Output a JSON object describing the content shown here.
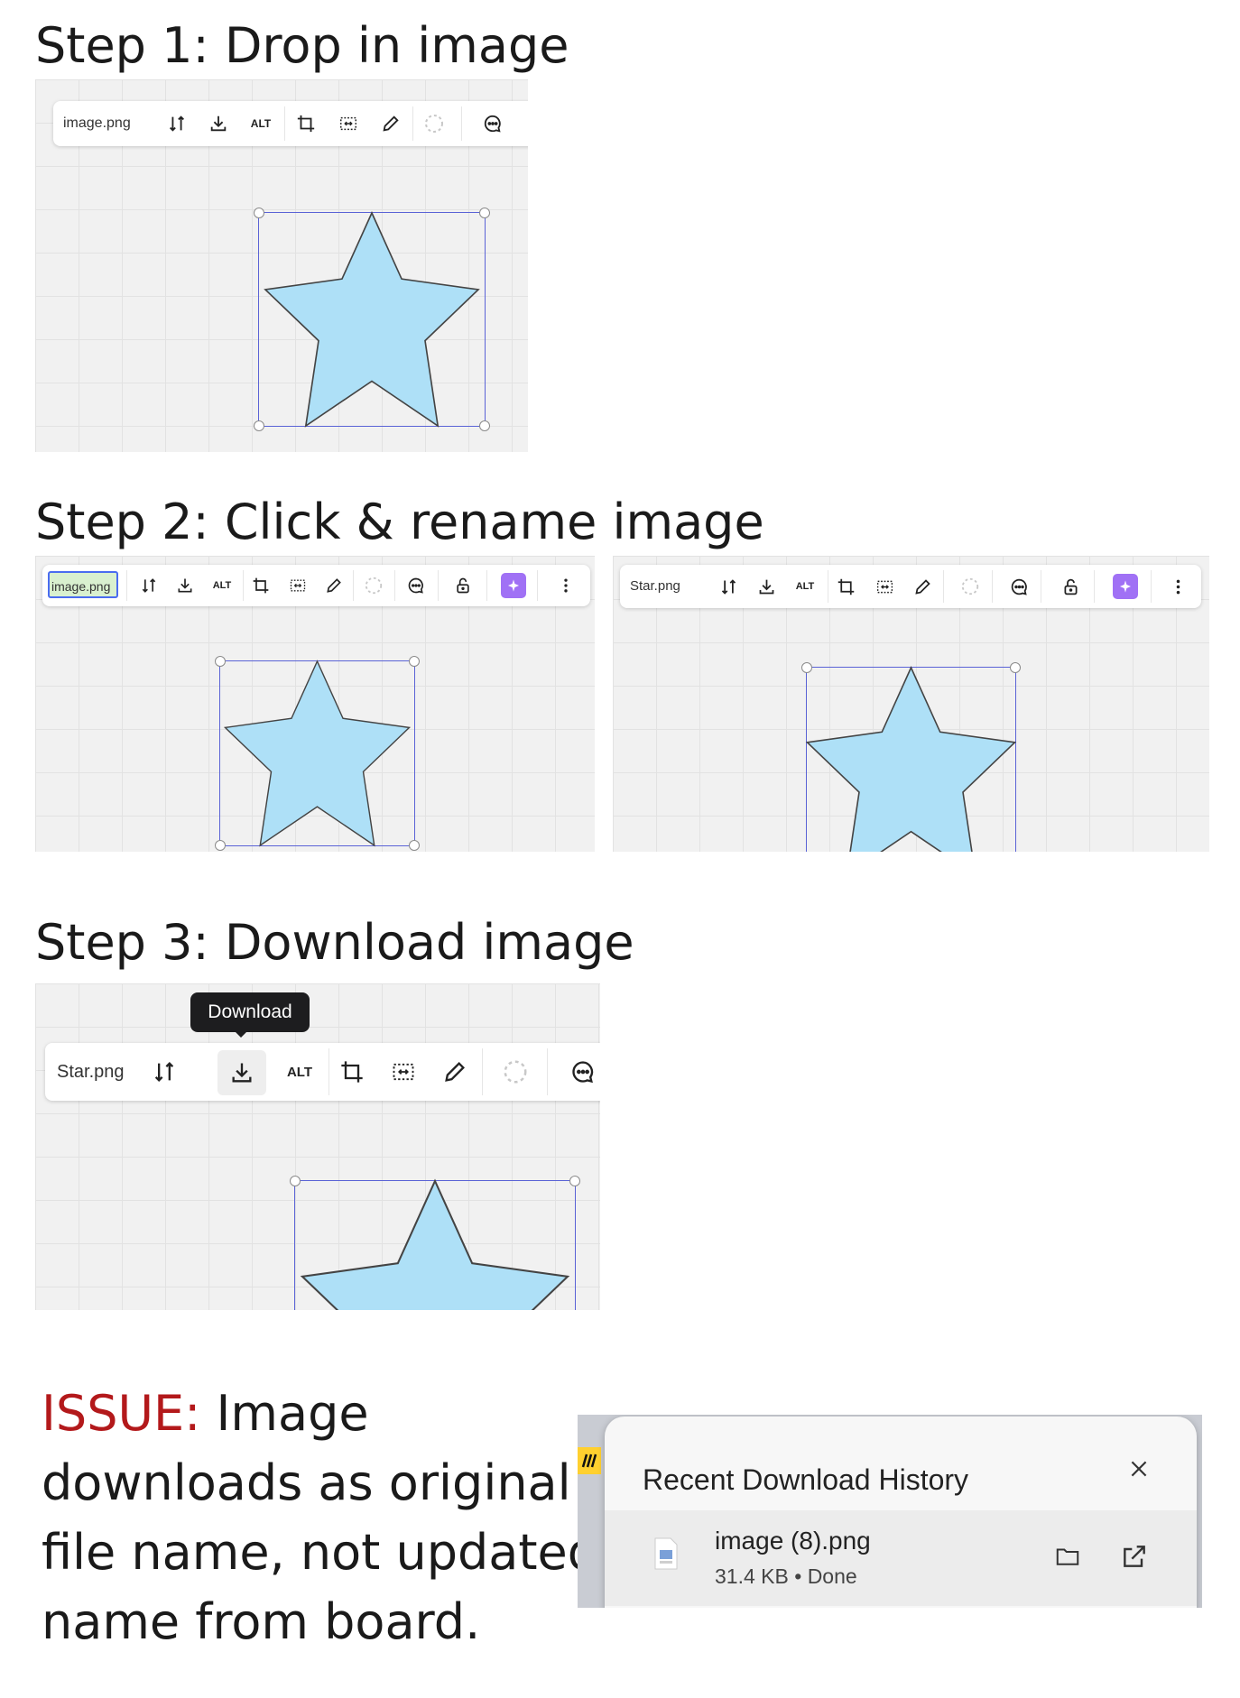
{
  "steps": {
    "step1": {
      "heading": "Step 1: Drop in image",
      "filename": "image.png",
      "alt_label": "ALT"
    },
    "step2": {
      "heading": "Step 2: Click & rename image",
      "filename_editing": "image.png",
      "filename_renamed": "Star.png",
      "alt_label": "ALT"
    },
    "step3": {
      "heading": "Step 3: Download image",
      "filename": "Star.png",
      "alt_label": "ALT",
      "tooltip": "Download"
    }
  },
  "issue": {
    "label": "ISSUE:",
    "text": " Image downloads as original file name, not updated name from board."
  },
  "download_history": {
    "title": "Recent Download History",
    "item": {
      "name": "image (8).png",
      "size": "31.4 KB",
      "status": "Done",
      "separator": "•"
    }
  },
  "colors": {
    "star_fill": "#aee0f7",
    "selection": "#5a63d6",
    "issue_red": "#b3191b",
    "ai_button": "#a071f5"
  },
  "icons": [
    "swap-icon",
    "download-icon",
    "crop-icon",
    "fit-icon",
    "pen-icon",
    "loading-icon",
    "comment-icon",
    "lock-icon",
    "ai-sparkle-icon",
    "more-icon",
    "close-icon",
    "folder-icon",
    "open-external-icon",
    "file-icon"
  ]
}
